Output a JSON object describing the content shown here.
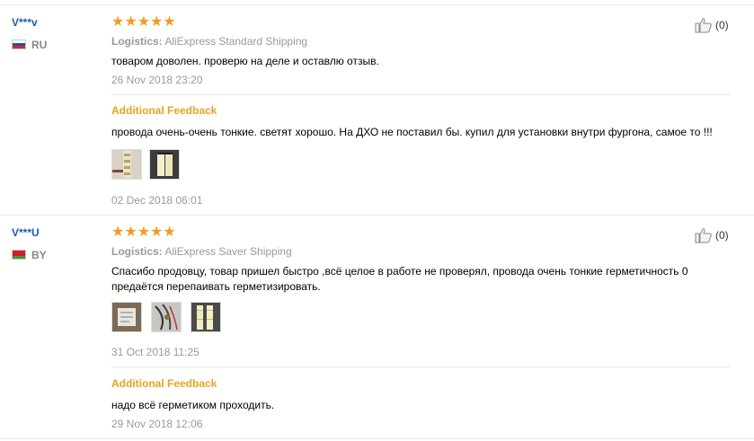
{
  "reviews": [
    {
      "user": "V***v",
      "country_code": "RU",
      "flag_colors": [
        "#ffffff",
        "#1f4fb0",
        "#d52b1e"
      ],
      "rating": 5,
      "stars_text": "★★★★★",
      "logistics_label": "Logistics:",
      "logistics_value": "AliExpress Standard Shipping",
      "text": "товаром доволен. проверю на деле и оставлю отзыв.",
      "date": "26 Nov 2018 23:20",
      "helpful_count": "(0)",
      "additional_feedback": {
        "heading": "Additional Feedback",
        "text": "провода очень-очень тонкие. светят хорошо. На ДХО не поставил бы. купил для установки внутри фургона, самое то !!!",
        "photos": [
          "led-strip-photo",
          "led-panel-photo"
        ],
        "date": "02 Dec 2018 06:01"
      }
    },
    {
      "user": "V***U",
      "country_code": "BY",
      "flag_colors": [
        "#cf2027",
        "#cf2027",
        "#3a9a3a"
      ],
      "rating": 5,
      "stars_text": "★★★★★",
      "logistics_label": "Logistics:",
      "logistics_value": "AliExpress Saver Shipping",
      "text": "Спасибо продовцу, товар пришел быстро ,всё целое в работе не проверял, провода очень тонкие герметичность 0 предаётся перепаивать герметизировать.",
      "photos": [
        "package-photo",
        "wires-photo",
        "led-strips-photo"
      ],
      "date": "31 Oct 2018 11:25",
      "helpful_count": "(0)",
      "additional_feedback": {
        "heading": "Additional Feedback",
        "text": "надо всё герметиком проходить.",
        "date": "29 Nov 2018 12:06"
      }
    }
  ]
}
